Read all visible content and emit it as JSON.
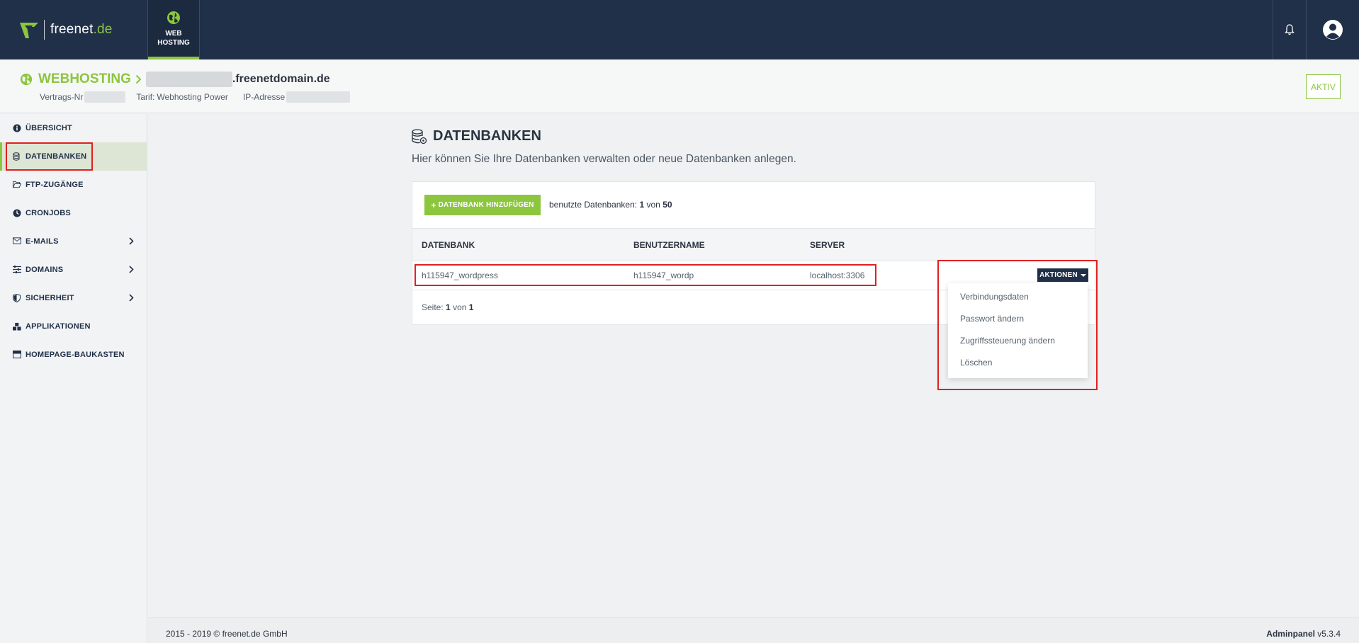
{
  "topbar": {
    "brand_name": "freenet",
    "brand_tld": ".de",
    "active_tab_line1": "WEB",
    "active_tab_line2": "HOSTING"
  },
  "subheader": {
    "section": "WEBHOSTING",
    "domain_suffix": ".freenetdomain.de",
    "contract_label": "Vertrags-Nr",
    "tariff_label": "Tarif:",
    "tariff_value": "Webhosting Power",
    "ip_label": "IP-Adresse",
    "status": "AKTIV"
  },
  "sidebar": {
    "items": [
      {
        "label": "ÜBERSICHT",
        "icon": "info-icon"
      },
      {
        "label": "DATENBANKEN",
        "icon": "database-icon"
      },
      {
        "label": "FTP-ZUGÄNGE",
        "icon": "folder-open-icon"
      },
      {
        "label": "CRONJOBS",
        "icon": "clock-icon"
      },
      {
        "label": "E-MAILS",
        "icon": "envelope-icon"
      },
      {
        "label": "DOMAINS",
        "icon": "sliders-icon"
      },
      {
        "label": "SICHERHEIT",
        "icon": "shield-icon"
      },
      {
        "label": "APPLIKATIONEN",
        "icon": "cubes-icon"
      },
      {
        "label": "HOMEPAGE-BAUKASTEN",
        "icon": "window-icon"
      }
    ]
  },
  "main": {
    "title": "DATENBANKEN",
    "description": "Hier können Sie Ihre Datenbanken verwalten oder neue Datenbanken anlegen.",
    "add_button": "DATENBANK HINZUFÜGEN",
    "usage_prefix": "benutzte Datenbanken:",
    "usage_used": "1",
    "usage_of": "von",
    "usage_total": "50",
    "columns": [
      "DATENBANK",
      "BENUTZERNAME",
      "SERVER"
    ],
    "rows": [
      {
        "database": "h115947_wordpress",
        "username": "h115947_wordp",
        "server": "localhost:3306"
      }
    ],
    "actions_button": "AKTIONEN",
    "actions_menu": [
      "Verbindungsdaten",
      "Passwort ändern",
      "Zugriffssteuerung ändern",
      "Löschen"
    ],
    "pager_prefix": "Seite:",
    "pager_current": "1",
    "pager_of": "von",
    "pager_total": "1"
  },
  "footer": {
    "copyright": "2015 - 2019 © freenet.de GmbH",
    "version_label": "Adminpanel",
    "version": "v5.3.4"
  },
  "colors": {
    "navy": "#213049",
    "green": "#8cc63f",
    "highlight": "#e02020"
  }
}
